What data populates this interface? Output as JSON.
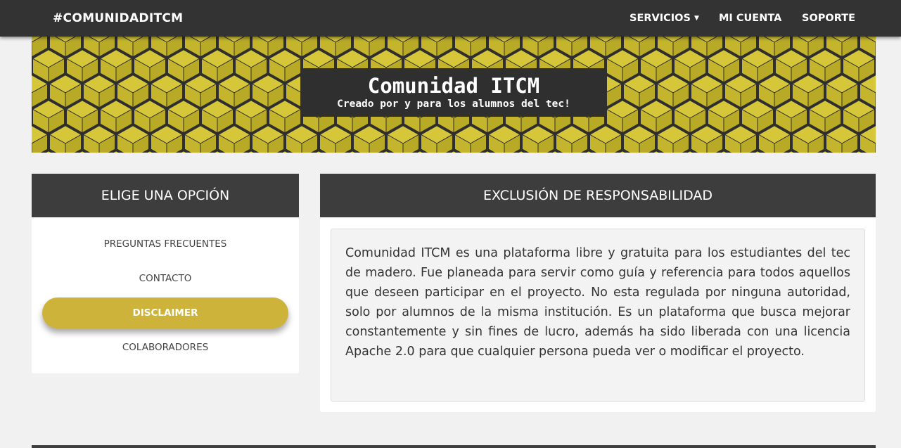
{
  "navbar": {
    "brand": "#COMUNIDADITCM",
    "items": [
      {
        "label": "SERVICIOS",
        "has_dropdown": true
      },
      {
        "label": "MI CUENTA"
      },
      {
        "label": "SOPORTE"
      }
    ]
  },
  "hero": {
    "title": "Comunidad ITCM",
    "subtitle": "Creado por y para los alumnos del tec!",
    "pattern_colors": {
      "top": "#d6c73a",
      "left": "#c4b52c",
      "right": "#b8aa27",
      "edge": "#2e2e2e"
    }
  },
  "options_panel": {
    "header": "ELIGE UNA OPCIÓN",
    "items": [
      {
        "label": "PREGUNTAS FRECUENTES",
        "active": false
      },
      {
        "label": "CONTACTO",
        "active": false
      },
      {
        "label": "DISCLAIMER",
        "active": true
      },
      {
        "label": "COLABORADORES",
        "active": false
      }
    ]
  },
  "disclaimer_panel": {
    "header": "EXCLUSIÓN DE RESPONSABILIDAD",
    "body": "Comunidad ITCM es una plataforma libre y gratuita para los estudiantes del tec de madero. Fue planeada para servir como guía y referencia para todos aquellos que deseen participar en el proyecto. No esta regulada por ninguna autoridad, solo por alumnos de la misma institución. Es un plataforma que busca mejorar constantemente y sin fines de lucro, además ha sido liberada con una licencia Apache 2.0 para que cualquier persona pueda ver o modificar el proyecto."
  },
  "colors": {
    "navbar": "#333333",
    "panel_header": "#3d3d3d",
    "accent": "#cdb33a",
    "page_bg": "#f1f1f1"
  }
}
